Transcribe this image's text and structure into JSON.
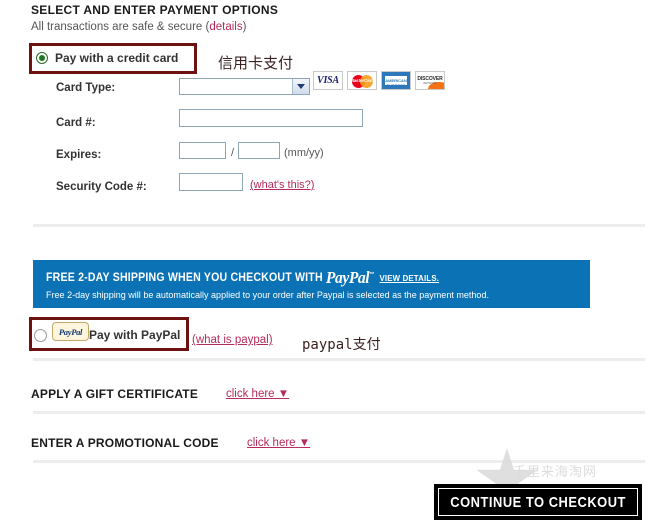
{
  "header": {
    "title": "SELECT AND ENTER PAYMENT OPTIONS",
    "subtitle_prefix": "All transactions are safe & secure (",
    "details_link": "details",
    "subtitle_suffix": ")"
  },
  "credit_card": {
    "option_label": "Pay with a credit card",
    "selected": true,
    "annotation_cn": "信用卡支付",
    "fields": {
      "card_type_label": "Card Type:",
      "card_type_value": "",
      "card_number_label": "Card #:",
      "card_number_value": "",
      "expires_label": "Expires:",
      "expires_month_value": "",
      "expires_year_value": "",
      "expires_separator": "/",
      "expires_hint": "(mm/yy)",
      "security_code_label": "Security Code #:",
      "security_code_value": "",
      "security_code_link": "(what's this?)"
    },
    "accepted_cards": [
      {
        "name": "visa-card-logo",
        "label": "VISA"
      },
      {
        "name": "mastercard-card-logo",
        "label": "MasterCard"
      },
      {
        "name": "amex-card-logo",
        "label": "AMERICAN EXPRESS"
      },
      {
        "name": "discover-card-logo",
        "label": "DISCOVER",
        "sublabel": "NETWORK"
      }
    ]
  },
  "paypal_banner": {
    "headline_prefix": "FREE 2-DAY SHIPPING WHEN YOU CHECKOUT WITH ",
    "brand": "PayPal",
    "trademark": "™",
    "view_details": "VIEW DETAILS.",
    "subline": "Free 2-day shipping will be automatically applied to your order after Paypal is selected as the payment method.",
    "background_color": "#0b72b5"
  },
  "paypal_option": {
    "badge_text": "PayPal",
    "option_label": "Pay with PayPal",
    "selected": false,
    "help_link": "(what is paypal)",
    "annotation_cn": "paypal支付"
  },
  "gift_certificate": {
    "title": "APPLY A GIFT CERTIFICATE",
    "link": "click here",
    "chevron": "▼"
  },
  "promotional_code": {
    "title": "ENTER A PROMOTIONAL CODE",
    "link": "click here",
    "chevron": "▼"
  },
  "checkout": {
    "button_label": "CONTINUE TO CHECKOUT"
  },
  "watermark": {
    "text": "千里来海淘网"
  },
  "colors": {
    "link": "#b52b5b",
    "annotation_box": "#6d1111",
    "banner_blue": "#0b72b5",
    "radio_selected": "#1f7a1f"
  }
}
